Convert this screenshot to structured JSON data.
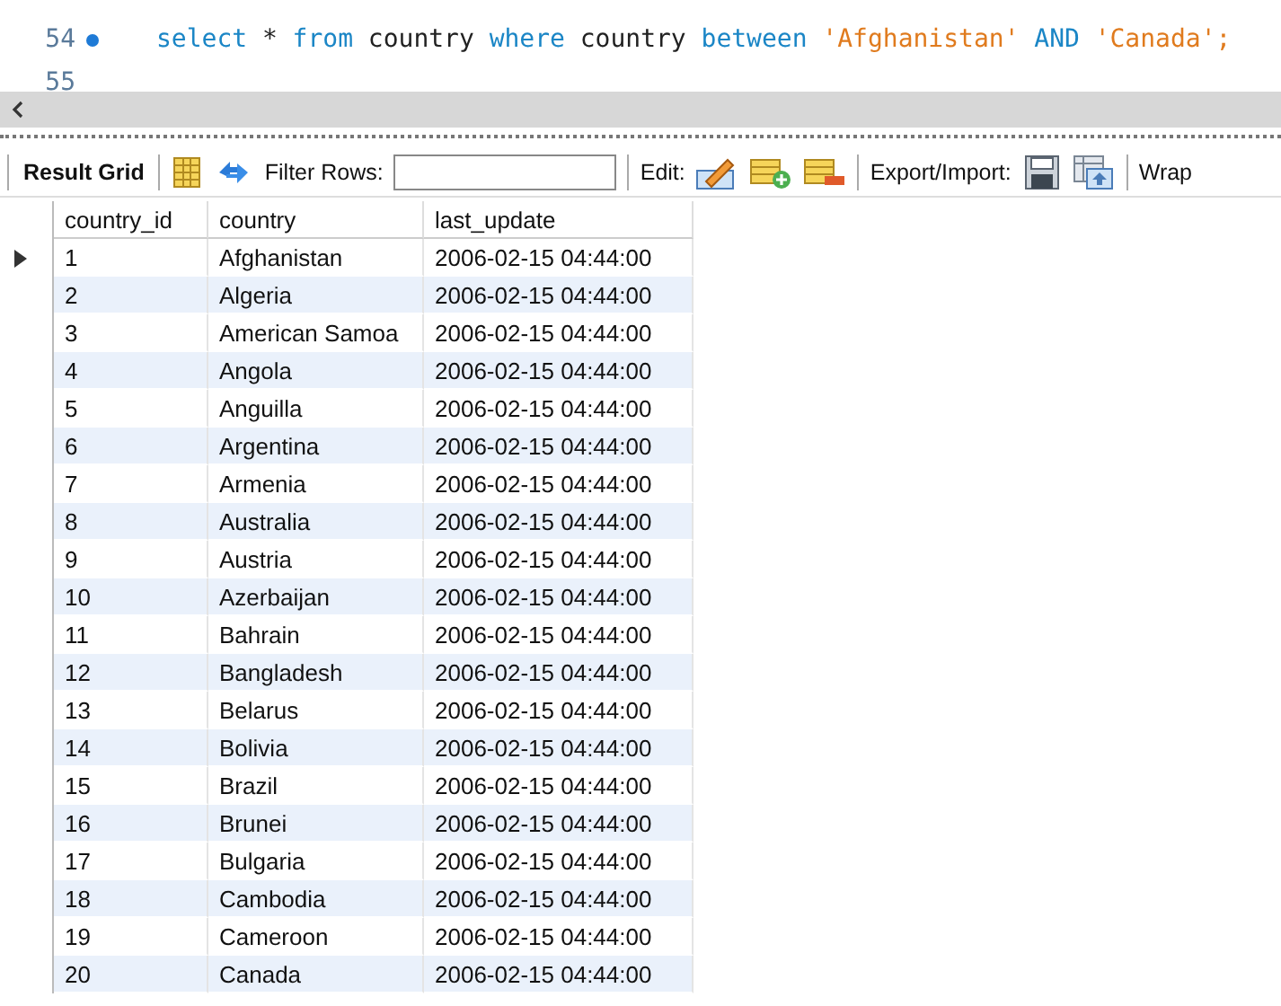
{
  "editor": {
    "lines": [
      {
        "number": "54",
        "breakpoint": true,
        "tokens": [
          {
            "kind": "keyword",
            "text": "select"
          },
          {
            "kind": "plain",
            "text": "*"
          },
          {
            "kind": "keyword",
            "text": "from"
          },
          {
            "kind": "plain",
            "text": "country"
          },
          {
            "kind": "keyword",
            "text": "where"
          },
          {
            "kind": "plain",
            "text": "country"
          },
          {
            "kind": "keyword",
            "text": "between"
          },
          {
            "kind": "string",
            "text": "'Afghanistan'"
          },
          {
            "kind": "keyword",
            "text": "AND"
          },
          {
            "kind": "string",
            "text": "'Canada';"
          }
        ]
      },
      {
        "number": "55",
        "breakpoint": false
      }
    ]
  },
  "toolbar": {
    "result_grid": "Result Grid",
    "filter_label": "Filter Rows:",
    "edit_label": "Edit:",
    "export_label": "Export/Import:",
    "wrap_label": "Wrap"
  },
  "grid": {
    "columns": [
      "country_id",
      "country",
      "last_update"
    ],
    "rows": [
      {
        "cells": [
          "1",
          "Afghanistan",
          "2006-02-15 04:44:00"
        ],
        "current": true
      },
      {
        "cells": [
          "2",
          "Algeria",
          "2006-02-15 04:44:00"
        ],
        "current": false
      },
      {
        "cells": [
          "3",
          "American Samoa",
          "2006-02-15 04:44:00"
        ],
        "current": false
      },
      {
        "cells": [
          "4",
          "Angola",
          "2006-02-15 04:44:00"
        ],
        "current": false
      },
      {
        "cells": [
          "5",
          "Anguilla",
          "2006-02-15 04:44:00"
        ],
        "current": false
      },
      {
        "cells": [
          "6",
          "Argentina",
          "2006-02-15 04:44:00"
        ],
        "current": false
      },
      {
        "cells": [
          "7",
          "Armenia",
          "2006-02-15 04:44:00"
        ],
        "current": false
      },
      {
        "cells": [
          "8",
          "Australia",
          "2006-02-15 04:44:00"
        ],
        "current": false
      },
      {
        "cells": [
          "9",
          "Austria",
          "2006-02-15 04:44:00"
        ],
        "current": false
      },
      {
        "cells": [
          "10",
          "Azerbaijan",
          "2006-02-15 04:44:00"
        ],
        "current": false
      },
      {
        "cells": [
          "11",
          "Bahrain",
          "2006-02-15 04:44:00"
        ],
        "current": false
      },
      {
        "cells": [
          "12",
          "Bangladesh",
          "2006-02-15 04:44:00"
        ],
        "current": false
      },
      {
        "cells": [
          "13",
          "Belarus",
          "2006-02-15 04:44:00"
        ],
        "current": false
      },
      {
        "cells": [
          "14",
          "Bolivia",
          "2006-02-15 04:44:00"
        ],
        "current": false
      },
      {
        "cells": [
          "15",
          "Brazil",
          "2006-02-15 04:44:00"
        ],
        "current": false
      },
      {
        "cells": [
          "16",
          "Brunei",
          "2006-02-15 04:44:00"
        ],
        "current": false
      },
      {
        "cells": [
          "17",
          "Bulgaria",
          "2006-02-15 04:44:00"
        ],
        "current": false
      },
      {
        "cells": [
          "18",
          "Cambodia",
          "2006-02-15 04:44:00"
        ],
        "current": false
      },
      {
        "cells": [
          "19",
          "Cameroon",
          "2006-02-15 04:44:00"
        ],
        "current": false
      },
      {
        "cells": [
          "20",
          "Canada",
          "2006-02-15 04:44:00"
        ],
        "current": false
      }
    ]
  }
}
